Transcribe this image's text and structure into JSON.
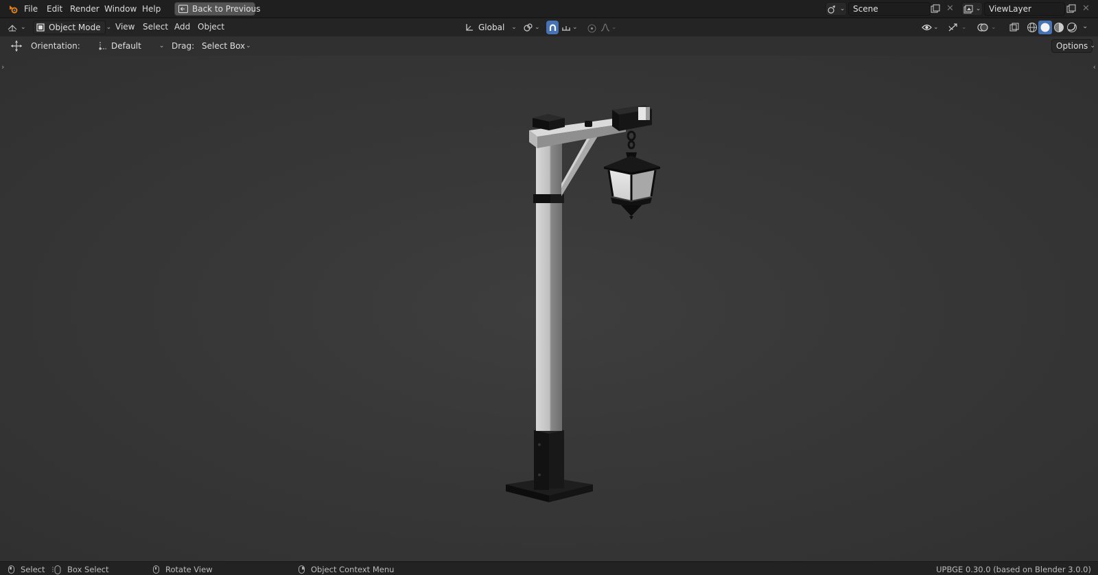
{
  "topbar": {
    "menu": [
      "File",
      "Edit",
      "Render",
      "Window",
      "Help"
    ],
    "back_button": "Back to Previous",
    "scene_name": "Scene",
    "view_layer": "ViewLayer"
  },
  "header": {
    "mode": "Object Mode",
    "menus": [
      "View",
      "Select",
      "Add",
      "Object"
    ],
    "transform_orientation": "Global"
  },
  "tool_options": {
    "orientation_label": "Orientation:",
    "orientation_value": "Default",
    "drag_label": "Drag:",
    "drag_value": "Select Box",
    "options_button": "Options"
  },
  "statusbar": {
    "select": "Select",
    "box_select": "Box Select",
    "rotate_view": "Rotate View",
    "context_menu": "Object Context Menu",
    "version": "UPBGE 0.30.0 (based on Blender 3.0.0)"
  },
  "colors": {
    "accent": "#e87d0d",
    "active_blue": "#4772b3",
    "viewport_bg": "#3a3a3a"
  },
  "viewport": {
    "object": "street lamp post with hanging lantern"
  }
}
